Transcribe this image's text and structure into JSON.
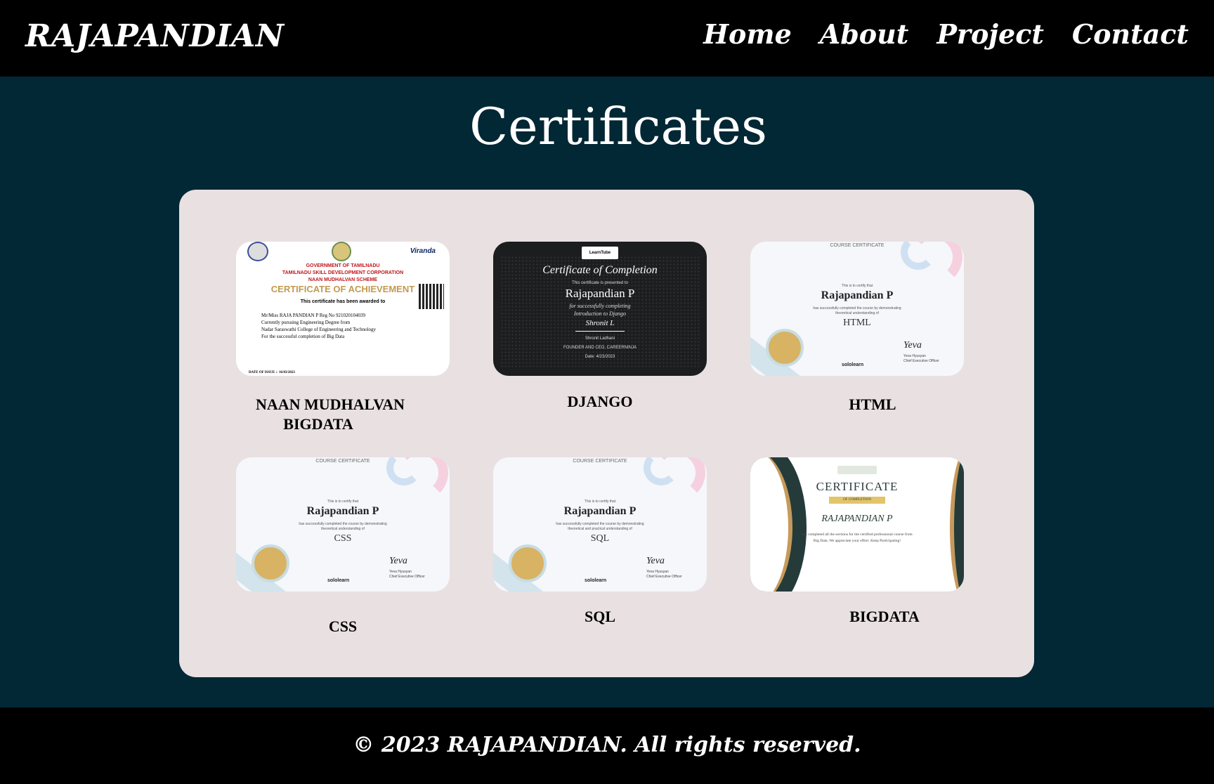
{
  "header": {
    "brand": "RAJAPANDIAN",
    "nav": [
      "Home",
      "About",
      "Project",
      "Contact"
    ]
  },
  "main": {
    "title": "Certificates",
    "certificates": [
      {
        "label_lines": [
          "NAAN MUDHALVAN",
          "BIGDATA"
        ],
        "image": {
          "header_lines": [
            "GOVERNMENT OF TAMILNADU",
            "TAMILNADU SKILL DEVELOPMENT CORPORATION",
            "NAAN MUDHALVAN SCHEME"
          ],
          "title": "CERTIFICATE OF ACHIEVEMENT",
          "subtitle": "This certificate has been awarded to",
          "body_lines": [
            "Mr/Miss  RAJA PANDIAN P    Reg No  921020104039",
            "Currently pursuing  Engineering Degree  from",
            "Nadar Saraswathi College of Engineering and Technology",
            "For the successful completion of  Big Data"
          ],
          "partner": "Viranda",
          "date": "DATE OF ISSUE :- 16/03/2023"
        }
      },
      {
        "label_lines": [
          "DJANGO"
        ],
        "image": {
          "badge": "LearnTube",
          "heading": "Certificate of Completion",
          "presented": "This certificate is presented to",
          "name": "Rajapandian P",
          "course_lines": [
            "for successfully completing",
            "Introduction to Django"
          ],
          "signature": "Shronit L",
          "footer_lines": [
            "Shronit Ladhani",
            "FOUNDER AND CEO, CAREERNINJA",
            "Date: 4/23/2023"
          ]
        }
      },
      {
        "label_lines": [
          "HTML"
        ],
        "image": {
          "top": "COURSE CERTIFICATE",
          "intro": "This is to certify that",
          "name": "Rajapandian P",
          "desc_lines": [
            "has successfully completed the course by demonstrating",
            "theoretical understanding of"
          ],
          "course": "HTML",
          "logo": "sololearn",
          "signature": "Yeva",
          "ceo_lines": [
            "Yeva Hyusyan",
            "Chief Executive Officer"
          ]
        }
      },
      {
        "label_lines": [
          "CSS"
        ],
        "image": {
          "top": "COURSE CERTIFICATE",
          "intro": "This is to certify that",
          "name": "Rajapandian P",
          "desc_lines": [
            "has successfully completed the course by demonstrating",
            "theoretical understanding of"
          ],
          "course": "CSS",
          "logo": "sololearn",
          "signature": "Yeva",
          "ceo_lines": [
            "Yeva Hyusyan",
            "Chief Executive Officer"
          ]
        }
      },
      {
        "label_lines": [
          "SQL"
        ],
        "image": {
          "top": "COURSE CERTIFICATE",
          "intro": "This is to certify that",
          "name": "Rajapandian P",
          "desc_lines": [
            "has successfully completed the course by demonstrating",
            "theoretical and practical understanding of"
          ],
          "course": "SQL",
          "logo": "sololearn",
          "signature": "Yeva",
          "ceo_lines": [
            "Yeva Hyusyan",
            "Chief Executive Officer"
          ]
        }
      },
      {
        "label_lines": [
          "BIGDATA"
        ],
        "image": {
          "heading": "CERTIFICATE",
          "ribbon": "OF COMPLETION",
          "name": "RAJAPANDIAN P",
          "desc_lines": [
            "has completed all the sections for the certified professional course from",
            "Big Data. We appreciate your effort. Keep Participating!"
          ]
        }
      }
    ]
  },
  "footer": {
    "text": "© 2023 RAJAPANDIAN. All rights reserved."
  },
  "colors": {
    "page_bg": "#022735",
    "bar_bg": "#000000",
    "panel_bg": "#e8e0e1"
  }
}
